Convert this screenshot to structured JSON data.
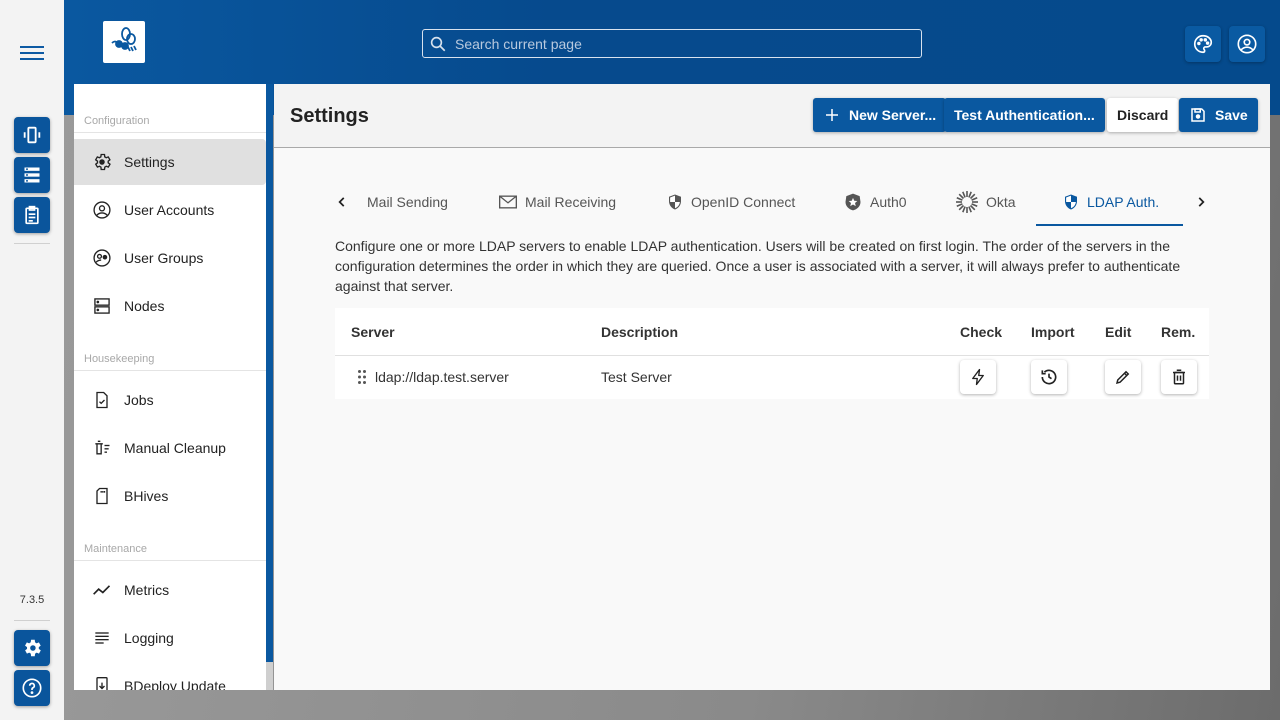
{
  "app": {
    "version": "7.3.5",
    "brand_color": "#0a58a0"
  },
  "rail": {
    "menu_icon": "hamburger-icon",
    "top_buttons": [
      {
        "name": "instances",
        "icon": "vibration-icon"
      },
      {
        "name": "servers",
        "icon": "storage-list-icon"
      },
      {
        "name": "reports",
        "icon": "clipboard-icon"
      }
    ],
    "bottom_buttons": [
      {
        "name": "admin-settings",
        "icon": "gear-icon"
      },
      {
        "name": "help",
        "icon": "help-icon"
      }
    ]
  },
  "header": {
    "search_placeholder": "Search current page",
    "search_value": "",
    "buttons": [
      {
        "name": "theme",
        "icon": "palette-icon"
      },
      {
        "name": "account",
        "icon": "account-circle-icon"
      }
    ]
  },
  "sidebar": {
    "sections": [
      {
        "title": "Configuration",
        "items": [
          {
            "label": "Settings",
            "icon": "gear-icon",
            "active": true
          },
          {
            "label": "User Accounts",
            "icon": "account-circle-icon"
          },
          {
            "label": "User Groups",
            "icon": "group-icon"
          },
          {
            "label": "Nodes",
            "icon": "dns-icon"
          }
        ]
      },
      {
        "title": "Housekeeping",
        "items": [
          {
            "label": "Jobs",
            "icon": "task-file-icon"
          },
          {
            "label": "Manual Cleanup",
            "icon": "delete-sweep-icon"
          },
          {
            "label": "BHives",
            "icon": "sd-card-icon"
          }
        ]
      },
      {
        "title": "Maintenance",
        "items": [
          {
            "label": "Metrics",
            "icon": "trending-icon"
          },
          {
            "label": "Logging",
            "icon": "notes-icon"
          },
          {
            "label": "BDeploy Update",
            "icon": "system-update-icon"
          }
        ]
      }
    ]
  },
  "main": {
    "title": "Settings",
    "toolbar": {
      "new_server": "New Server...",
      "test_auth": "Test Authentication...",
      "discard": "Discard",
      "save": "Save"
    },
    "tabs": [
      {
        "label": "Mail Sending",
        "icon": ""
      },
      {
        "label": "Mail Receiving",
        "icon": "mail-icon"
      },
      {
        "label": "OpenID Connect",
        "icon": "shield-icon"
      },
      {
        "label": "Auth0",
        "icon": "auth0-icon"
      },
      {
        "label": "Okta",
        "icon": "okta-icon"
      },
      {
        "label": "LDAP Auth.",
        "icon": "shield-icon",
        "active": true
      }
    ],
    "description": "Configure one or more LDAP servers to enable LDAP authentication. Users will be created on first login. The order of the servers in the configuration determines the order in which they are queried. Once a user is associated with a server, it will always prefer to authenticate against that server.",
    "table": {
      "columns": [
        "Server",
        "Description",
        "Check",
        "Import",
        "Edit",
        "Rem."
      ],
      "rows": [
        {
          "server": "ldap://ldap.test.server",
          "description": "Test Server"
        }
      ]
    }
  }
}
